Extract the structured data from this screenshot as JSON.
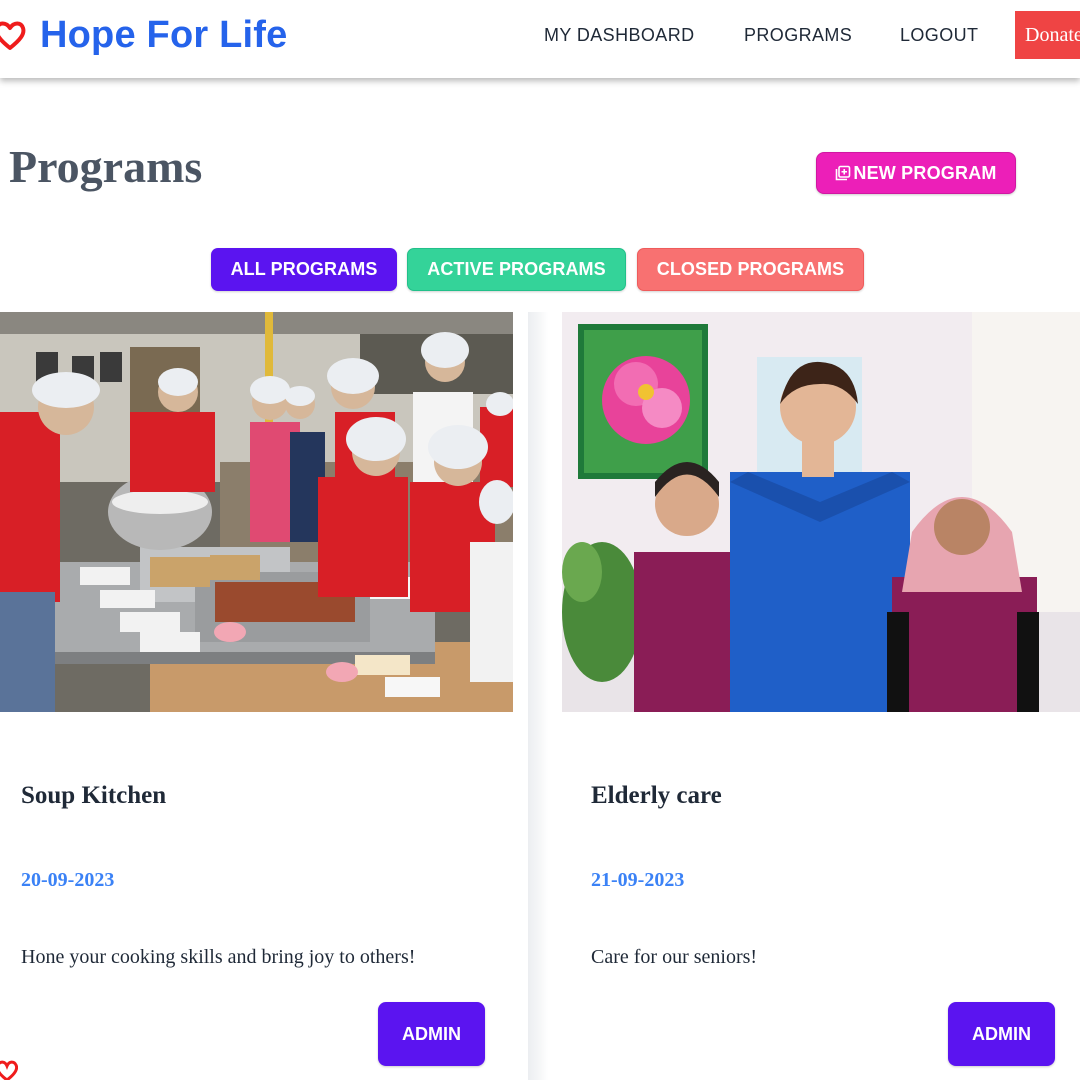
{
  "header": {
    "brand": "Hope For Life",
    "nav": {
      "dashboard": "MY DASHBOARD",
      "programs": "PROGRAMS",
      "logout": "LOGOUT",
      "donate": "Donate"
    }
  },
  "page": {
    "title": "Programs",
    "new_program_label": "NEW PROGRAM"
  },
  "filters": {
    "all": "ALL PROGRAMS",
    "active": "ACTIVE PROGRAMS",
    "closed": "CLOSED PROGRAMS"
  },
  "programs": [
    {
      "title": "Soup Kitchen",
      "date": "20-09-2023",
      "description": "Hone your cooking skills and bring joy to others!",
      "admin_label": "ADMIN",
      "image": "volunteers-serving-food-photo"
    },
    {
      "title": "Elderly care",
      "date": "21-09-2023",
      "description": "Care for our seniors!",
      "admin_label": "ADMIN",
      "image": "medical-staff-group-photo"
    }
  ],
  "colors": {
    "brand_blue": "#2563eb",
    "donate_red": "#ef4444",
    "new_program_pink": "#ec1fb8",
    "primary_purple": "#5b14f0",
    "active_green": "#34d399",
    "closed_red": "#f87171",
    "date_blue": "#3b82f6"
  }
}
